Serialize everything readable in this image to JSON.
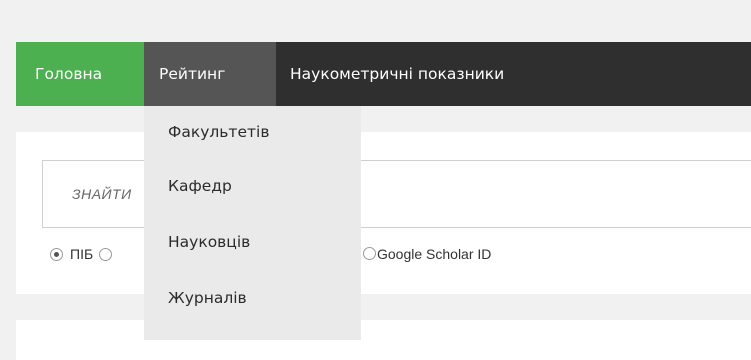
{
  "nav": {
    "home": "Головна",
    "rating": "Рейтинг",
    "metrics": "Наукометричні показники"
  },
  "dropdown": {
    "items": [
      "Факультетів",
      "Кафедр",
      "Науковців",
      "Журналів"
    ]
  },
  "search": {
    "placeholder": "ЗНАЙТИ"
  },
  "search_by": {
    "selected": "ПІБ",
    "options": [
      "ПІБ",
      "",
      "Google Scholar ID"
    ]
  },
  "colors": {
    "home_active": "#4caf50",
    "navbar": "#2f2f2f",
    "dropdown_bg": "#eaeaea"
  }
}
